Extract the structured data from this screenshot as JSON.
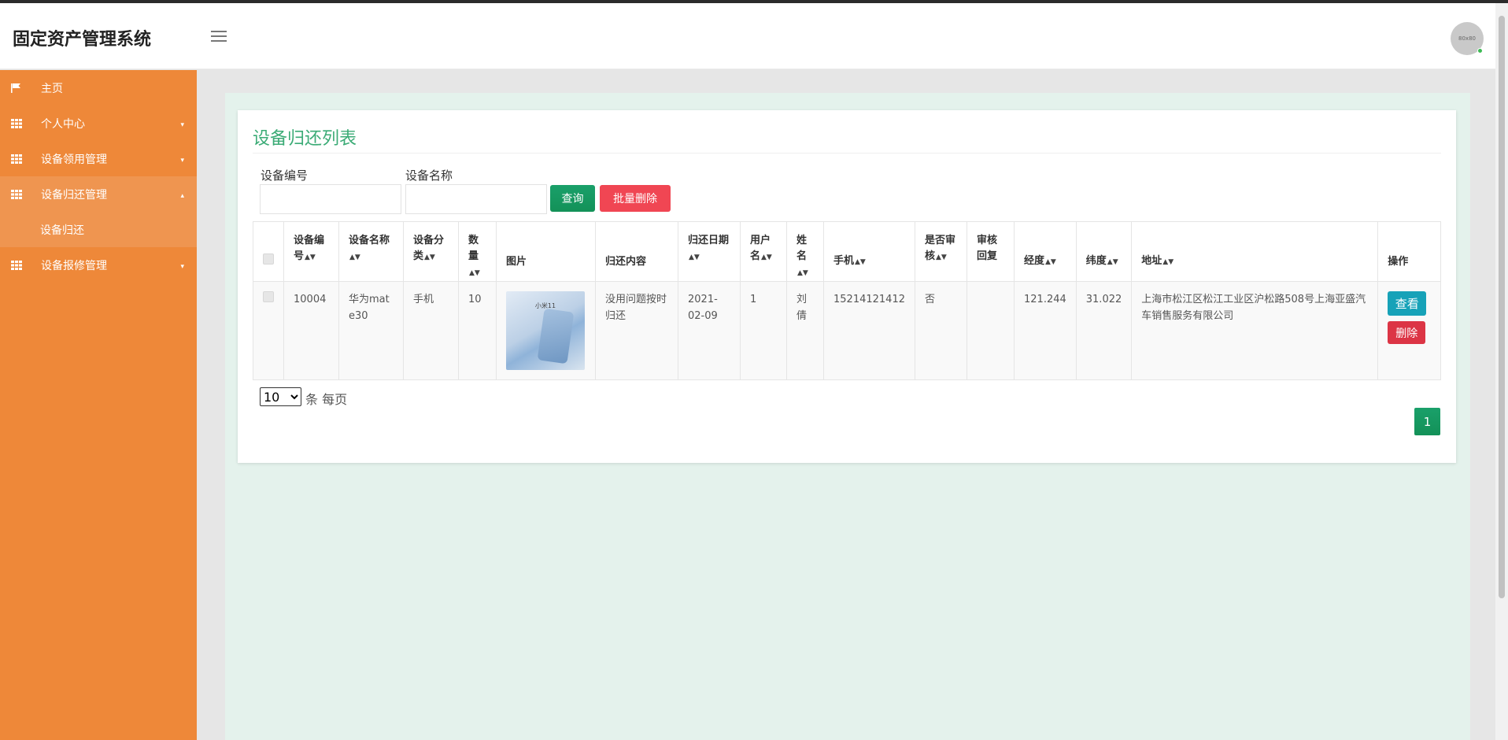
{
  "app": {
    "title": "固定资产管理系统",
    "avatar_text": "80x80"
  },
  "sidebar": {
    "items": [
      {
        "label": "主页",
        "icon": "flag-icon"
      },
      {
        "label": "个人中心",
        "icon": "grid-icon"
      },
      {
        "label": "设备领用管理",
        "icon": "grid-icon"
      },
      {
        "label": "设备归还管理",
        "icon": "grid-icon",
        "active": true
      },
      {
        "label": "设备报修管理",
        "icon": "grid-icon"
      }
    ],
    "sub_items": [
      {
        "label": "设备归还"
      }
    ]
  },
  "page": {
    "title": "设备归还列表"
  },
  "search": {
    "field1_label": "设备编号",
    "field1_value": "",
    "field2_label": "设备名称",
    "field2_value": "",
    "query_label": "查询",
    "batch_delete_label": "批量删除"
  },
  "table": {
    "headers": [
      "设备编号",
      "设备名称",
      "设备分类",
      "数量",
      "图片",
      "归还内容",
      "归还日期",
      "用户名",
      "姓名",
      "手机",
      "是否审核",
      "审核回复",
      "经度",
      "纬度",
      "地址",
      "操作"
    ],
    "rows": [
      {
        "code": "10004",
        "name": "华为mate30",
        "category": "手机",
        "quantity": "10",
        "image_caption": "小米11",
        "content": "没用问题按时归还",
        "date": "2021-02-09",
        "username": "1",
        "realname": "刘倩",
        "phone": "15214121412",
        "reviewed": "否",
        "reply": "",
        "longitude": "121.244",
        "latitude": "31.022",
        "address": "上海市松江区松江工业区沪松路508号上海亚盛汽车销售服务有限公司",
        "view_label": "查看",
        "delete_label": "删除"
      }
    ]
  },
  "pagination": {
    "page_size": "10",
    "page_size_suffix": "条 每页",
    "current_page": "1"
  },
  "colors": {
    "sidebar": "#ee8839",
    "accent": "#3bab76",
    "danger": "#dc3545",
    "info": "#17a2b8"
  }
}
